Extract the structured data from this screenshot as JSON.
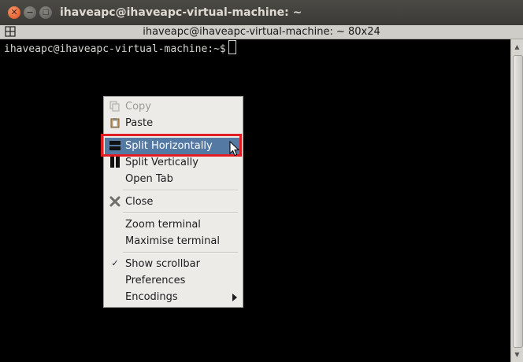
{
  "window": {
    "title": "ihaveapc@ihaveapc-virtual-machine: ~",
    "close_glyph": "✕",
    "minimize_glyph": "−",
    "maximize_glyph": "□"
  },
  "terminal": {
    "header": "ihaveapc@ihaveapc-virtual-machine: ~ 80x24",
    "prompt": "ihaveapc@ihaveapc-virtual-machine:~$"
  },
  "menu": {
    "copy": "Copy",
    "paste": "Paste",
    "split_horizontally": "Split Horizontally",
    "split_vertically": "Split Vertically",
    "open_tab": "Open Tab",
    "close": "Close",
    "zoom_terminal": "Zoom terminal",
    "maximise_terminal": "Maximise terminal",
    "show_scrollbar": "Show scrollbar",
    "preferences": "Preferences",
    "encodings": "Encodings",
    "check_glyph": "✓"
  },
  "colors": {
    "highlight": "#e01e24",
    "menu_active": "#5479a3",
    "terminal_bg": "#000000"
  }
}
